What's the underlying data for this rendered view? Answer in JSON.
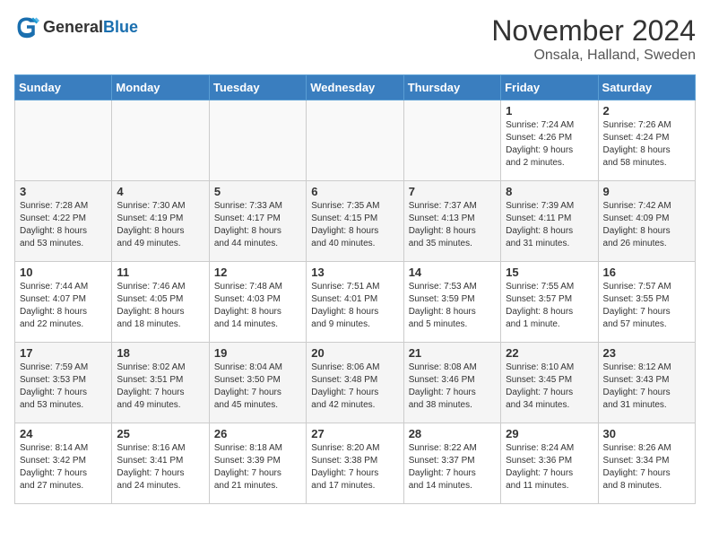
{
  "logo": {
    "general": "General",
    "blue": "Blue"
  },
  "title": "November 2024",
  "location": "Onsala, Halland, Sweden",
  "days_of_week": [
    "Sunday",
    "Monday",
    "Tuesday",
    "Wednesday",
    "Thursday",
    "Friday",
    "Saturday"
  ],
  "weeks": [
    [
      {
        "day": "",
        "info": ""
      },
      {
        "day": "",
        "info": ""
      },
      {
        "day": "",
        "info": ""
      },
      {
        "day": "",
        "info": ""
      },
      {
        "day": "",
        "info": ""
      },
      {
        "day": "1",
        "info": "Sunrise: 7:24 AM\nSunset: 4:26 PM\nDaylight: 9 hours\nand 2 minutes."
      },
      {
        "day": "2",
        "info": "Sunrise: 7:26 AM\nSunset: 4:24 PM\nDaylight: 8 hours\nand 58 minutes."
      }
    ],
    [
      {
        "day": "3",
        "info": "Sunrise: 7:28 AM\nSunset: 4:22 PM\nDaylight: 8 hours\nand 53 minutes."
      },
      {
        "day": "4",
        "info": "Sunrise: 7:30 AM\nSunset: 4:19 PM\nDaylight: 8 hours\nand 49 minutes."
      },
      {
        "day": "5",
        "info": "Sunrise: 7:33 AM\nSunset: 4:17 PM\nDaylight: 8 hours\nand 44 minutes."
      },
      {
        "day": "6",
        "info": "Sunrise: 7:35 AM\nSunset: 4:15 PM\nDaylight: 8 hours\nand 40 minutes."
      },
      {
        "day": "7",
        "info": "Sunrise: 7:37 AM\nSunset: 4:13 PM\nDaylight: 8 hours\nand 35 minutes."
      },
      {
        "day": "8",
        "info": "Sunrise: 7:39 AM\nSunset: 4:11 PM\nDaylight: 8 hours\nand 31 minutes."
      },
      {
        "day": "9",
        "info": "Sunrise: 7:42 AM\nSunset: 4:09 PM\nDaylight: 8 hours\nand 26 minutes."
      }
    ],
    [
      {
        "day": "10",
        "info": "Sunrise: 7:44 AM\nSunset: 4:07 PM\nDaylight: 8 hours\nand 22 minutes."
      },
      {
        "day": "11",
        "info": "Sunrise: 7:46 AM\nSunset: 4:05 PM\nDaylight: 8 hours\nand 18 minutes."
      },
      {
        "day": "12",
        "info": "Sunrise: 7:48 AM\nSunset: 4:03 PM\nDaylight: 8 hours\nand 14 minutes."
      },
      {
        "day": "13",
        "info": "Sunrise: 7:51 AM\nSunset: 4:01 PM\nDaylight: 8 hours\nand 9 minutes."
      },
      {
        "day": "14",
        "info": "Sunrise: 7:53 AM\nSunset: 3:59 PM\nDaylight: 8 hours\nand 5 minutes."
      },
      {
        "day": "15",
        "info": "Sunrise: 7:55 AM\nSunset: 3:57 PM\nDaylight: 8 hours\nand 1 minute."
      },
      {
        "day": "16",
        "info": "Sunrise: 7:57 AM\nSunset: 3:55 PM\nDaylight: 7 hours\nand 57 minutes."
      }
    ],
    [
      {
        "day": "17",
        "info": "Sunrise: 7:59 AM\nSunset: 3:53 PM\nDaylight: 7 hours\nand 53 minutes."
      },
      {
        "day": "18",
        "info": "Sunrise: 8:02 AM\nSunset: 3:51 PM\nDaylight: 7 hours\nand 49 minutes."
      },
      {
        "day": "19",
        "info": "Sunrise: 8:04 AM\nSunset: 3:50 PM\nDaylight: 7 hours\nand 45 minutes."
      },
      {
        "day": "20",
        "info": "Sunrise: 8:06 AM\nSunset: 3:48 PM\nDaylight: 7 hours\nand 42 minutes."
      },
      {
        "day": "21",
        "info": "Sunrise: 8:08 AM\nSunset: 3:46 PM\nDaylight: 7 hours\nand 38 minutes."
      },
      {
        "day": "22",
        "info": "Sunrise: 8:10 AM\nSunset: 3:45 PM\nDaylight: 7 hours\nand 34 minutes."
      },
      {
        "day": "23",
        "info": "Sunrise: 8:12 AM\nSunset: 3:43 PM\nDaylight: 7 hours\nand 31 minutes."
      }
    ],
    [
      {
        "day": "24",
        "info": "Sunrise: 8:14 AM\nSunset: 3:42 PM\nDaylight: 7 hours\nand 27 minutes."
      },
      {
        "day": "25",
        "info": "Sunrise: 8:16 AM\nSunset: 3:41 PM\nDaylight: 7 hours\nand 24 minutes."
      },
      {
        "day": "26",
        "info": "Sunrise: 8:18 AM\nSunset: 3:39 PM\nDaylight: 7 hours\nand 21 minutes."
      },
      {
        "day": "27",
        "info": "Sunrise: 8:20 AM\nSunset: 3:38 PM\nDaylight: 7 hours\nand 17 minutes."
      },
      {
        "day": "28",
        "info": "Sunrise: 8:22 AM\nSunset: 3:37 PM\nDaylight: 7 hours\nand 14 minutes."
      },
      {
        "day": "29",
        "info": "Sunrise: 8:24 AM\nSunset: 3:36 PM\nDaylight: 7 hours\nand 11 minutes."
      },
      {
        "day": "30",
        "info": "Sunrise: 8:26 AM\nSunset: 3:34 PM\nDaylight: 7 hours\nand 8 minutes."
      }
    ]
  ]
}
